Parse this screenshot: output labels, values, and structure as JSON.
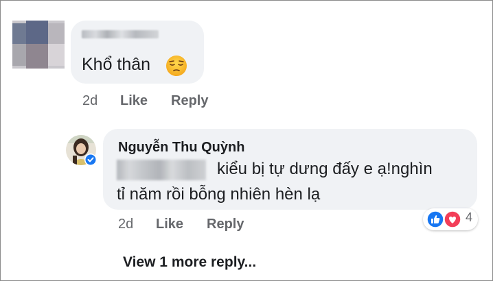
{
  "comment1": {
    "text": "Khổ thân",
    "emoji": "pensive-face-emoji",
    "time": "2d",
    "like_label": "Like",
    "reply_label": "Reply"
  },
  "comment2": {
    "author": "Nguyễn Thu Quỳnh",
    "line1": "kiểu bị tự dưng đấy e ạ!nghìn",
    "line2": "tỉ năm rồi bỗng nhiên hèn lạ",
    "time": "2d",
    "like_label": "Like",
    "reply_label": "Reply",
    "reactions": {
      "icons": [
        "like-reaction-icon",
        "love-reaction-icon"
      ],
      "count": "4"
    }
  },
  "more_replies_label": "View 1 more reply...",
  "colors": {
    "bubble": "#f0f2f5",
    "meta_text": "#65676b",
    "like_blue": "#1877f2",
    "love_red": "#f33e58",
    "verified_blue": "#1877f2"
  }
}
